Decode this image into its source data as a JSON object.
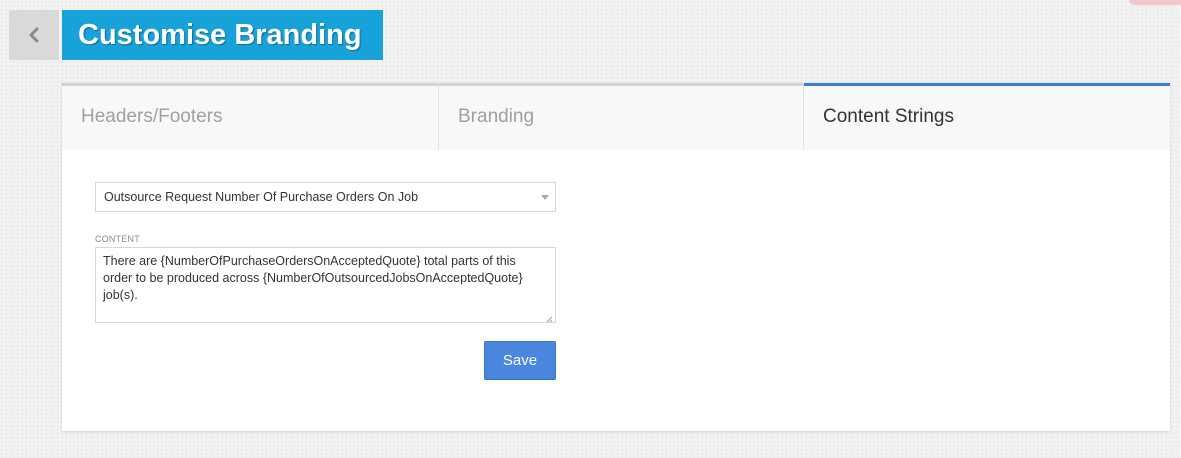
{
  "header": {
    "back_icon": "chevron-left-icon",
    "title": "Customise Branding"
  },
  "tabs": [
    {
      "label": "Headers/Footers",
      "active": false
    },
    {
      "label": "Branding",
      "active": false
    },
    {
      "label": "Content Strings",
      "active": true
    }
  ],
  "form": {
    "selected_string": "Outsource Request Number Of Purchase Orders On Job",
    "select_icon": "caret-down-icon",
    "content_label": "CONTENT",
    "content_value": "There are {NumberOfPurchaseOrdersOnAcceptedQuote} total parts of this order to be produced across {NumberOfOutsourcedJobsOnAcceptedQuote} job(s).",
    "save_label": "Save"
  },
  "colors": {
    "title_background": "#17a2d9",
    "active_tab_accent": "#3c7dd9",
    "save_button": "#4a88df"
  }
}
